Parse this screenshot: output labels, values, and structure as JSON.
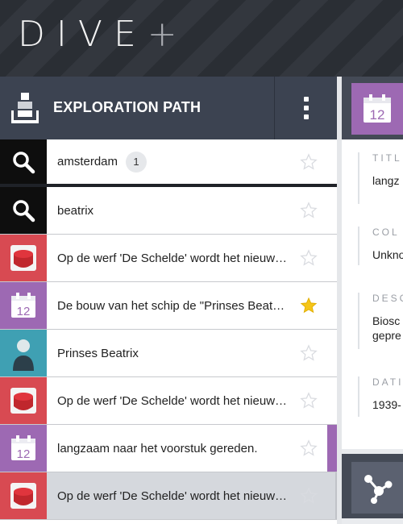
{
  "app": {
    "logo_text": "DIVE",
    "logo_plus": "+"
  },
  "exploration_path": {
    "title": "EXPLORATION PATH",
    "items": [
      {
        "icon": "search-icon",
        "color": "black",
        "label": "amsterdam",
        "count": "1",
        "starred": false
      },
      {
        "icon": "search-icon",
        "color": "black",
        "label": "beatrix",
        "starred": false
      },
      {
        "icon": "media-object-icon",
        "color": "red",
        "label": "Op de werf 'De Schelde' wordt het nieuw…",
        "starred": false
      },
      {
        "icon": "calendar-icon",
        "color": "purple",
        "label": "De bouw van het schip de \"Prinses Beat…",
        "starred": true
      },
      {
        "icon": "person-icon",
        "color": "teal",
        "label": "Prinses Beatrix",
        "starred": false
      },
      {
        "icon": "media-object-icon",
        "color": "red",
        "label": "Op de werf 'De Schelde' wordt het nieuw…",
        "starred": false
      },
      {
        "icon": "calendar-icon",
        "color": "purple",
        "label": "langzaam naar het voorstuk gereden.",
        "starred": false,
        "active": true
      },
      {
        "icon": "media-object-icon",
        "color": "red",
        "label": "Op de werf 'De Schelde' wordt het nieuw…",
        "starred": false,
        "selected": true
      }
    ]
  },
  "detail": {
    "icon_day": "12",
    "fields": [
      {
        "key": "TITL",
        "value": "langz"
      },
      {
        "key": "COL",
        "value": "Unkno"
      },
      {
        "key": "DESC",
        "value": "Biosc",
        "value2": "gepre"
      },
      {
        "key": "DATI",
        "value": "1939-"
      }
    ],
    "graph_icon": "graph-icon"
  },
  "colors": {
    "accent_purple": "#9d69b3",
    "accent_red": "#d84a52",
    "accent_teal": "#3fa0b3",
    "header_dark": "#3c4351",
    "star_gold": "#f5c518"
  }
}
